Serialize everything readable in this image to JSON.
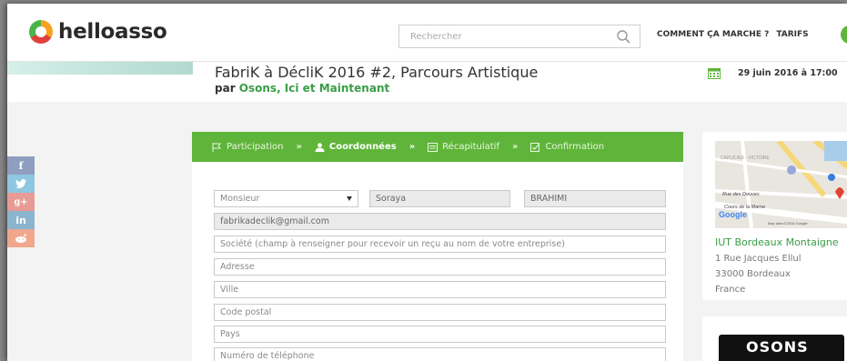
{
  "header": {
    "logo_text": "helloasso",
    "search_placeholder": "Rechercher",
    "nav": [
      "COMMENT ÇA MARCHE ?",
      "TARIFS"
    ]
  },
  "event": {
    "title": "FabriK à DécliK 2016 #2, Parcours Artistique",
    "by_label": "par",
    "organizer": "Osons, Ici et Maintenant",
    "date": "29 juin 2016 à 17:00"
  },
  "social": [
    {
      "icon": "facebook-icon",
      "glyph": "f",
      "color": "#8f9ec0"
    },
    {
      "icon": "twitter-icon",
      "glyph": "🐦",
      "color": "#8fc6e0"
    },
    {
      "icon": "google-plus-icon",
      "glyph": "g+",
      "color": "#e89a94"
    },
    {
      "icon": "linkedin-icon",
      "glyph": "in",
      "color": "#8bb5cf"
    },
    {
      "icon": "reddit-icon",
      "glyph": "◕",
      "color": "#f0a78e"
    }
  ],
  "steps": {
    "participation": "Participation",
    "coordonnees": "Coordonnées",
    "recapitulatif": "Récapitulatif",
    "confirmation": "Confirmation"
  },
  "form": {
    "civility": "Monsieur",
    "firstname": "Soraya",
    "lastname": "BRAHIMI",
    "email": "fabrikadeclik@gmail.com",
    "company_placeholder": "Société (champ à renseigner pour recevoir un reçu au nom de votre entreprise)",
    "address_placeholder": "Adresse",
    "city_placeholder": "Ville",
    "zip_placeholder": "Code postal",
    "country_placeholder": "Pays",
    "phone_placeholder": "Numéro de téléphone"
  },
  "venue": {
    "name": "IUT Bordeaux Montaigne",
    "street": "1 Rue Jacques Ellul",
    "city": "33000 Bordeaux",
    "country": "France"
  },
  "map": {
    "district": "CAPUCINS - VICTOIRE",
    "street1": "Rue des Douves",
    "street2": "Cours de la Marne",
    "brand": "Google",
    "credit": "Map data ©2016 Google"
  },
  "partner_logo_text": "OSONS",
  "colors": {
    "accent_green": "#5fb53a",
    "org_green": "#3a9d46"
  }
}
